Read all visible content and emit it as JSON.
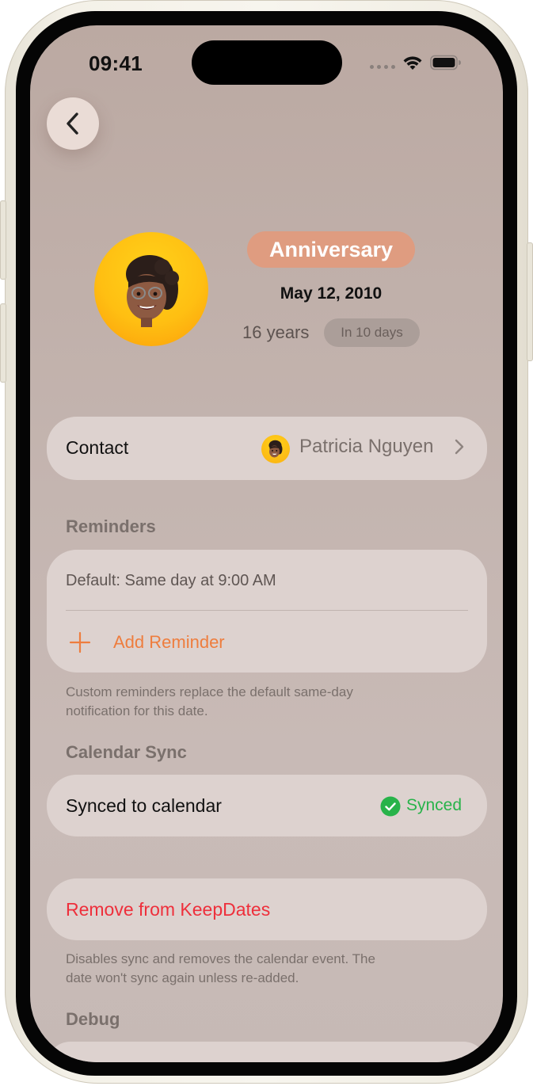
{
  "status_bar": {
    "time": "09:41",
    "icons": [
      "cellular-dots-icon",
      "wifi-icon",
      "battery-icon"
    ]
  },
  "nav": {
    "back_icon": "chevron-left-icon"
  },
  "header": {
    "badge": "Anniversary",
    "date": "May 12, 2010",
    "years": "16 years",
    "countdown": "In 10 days",
    "badge_color": "#df9c80"
  },
  "contact": {
    "label": "Contact",
    "name": "Patricia Nguyen",
    "chevron_icon": "chevron-right-icon"
  },
  "reminders": {
    "section_title": "Reminders",
    "default_text": "Default: Same day at 9:00 AM",
    "add_label": "Add Reminder",
    "add_icon": "plus-icon",
    "footnote_line1": "Custom reminders replace the default same-day",
    "footnote_line2": "notification for this date."
  },
  "calendar_sync": {
    "section_title": "Calendar Sync",
    "label": "Synced to calendar",
    "status": "Synced",
    "status_icon": "checkmark-circle-icon",
    "status_color": "#28b34a"
  },
  "remove": {
    "label": "Remove from KeepDates",
    "color": "#ee2f3b",
    "footnote_line1": "Disables sync and removes the calendar event. The",
    "footnote_line2": "date won't sync again unless re-added."
  },
  "debug": {
    "section_title": "Debug"
  },
  "colors": {
    "accent": "#ee7d3e",
    "background": "#c4b5b0",
    "card": "#ddd2cf"
  }
}
